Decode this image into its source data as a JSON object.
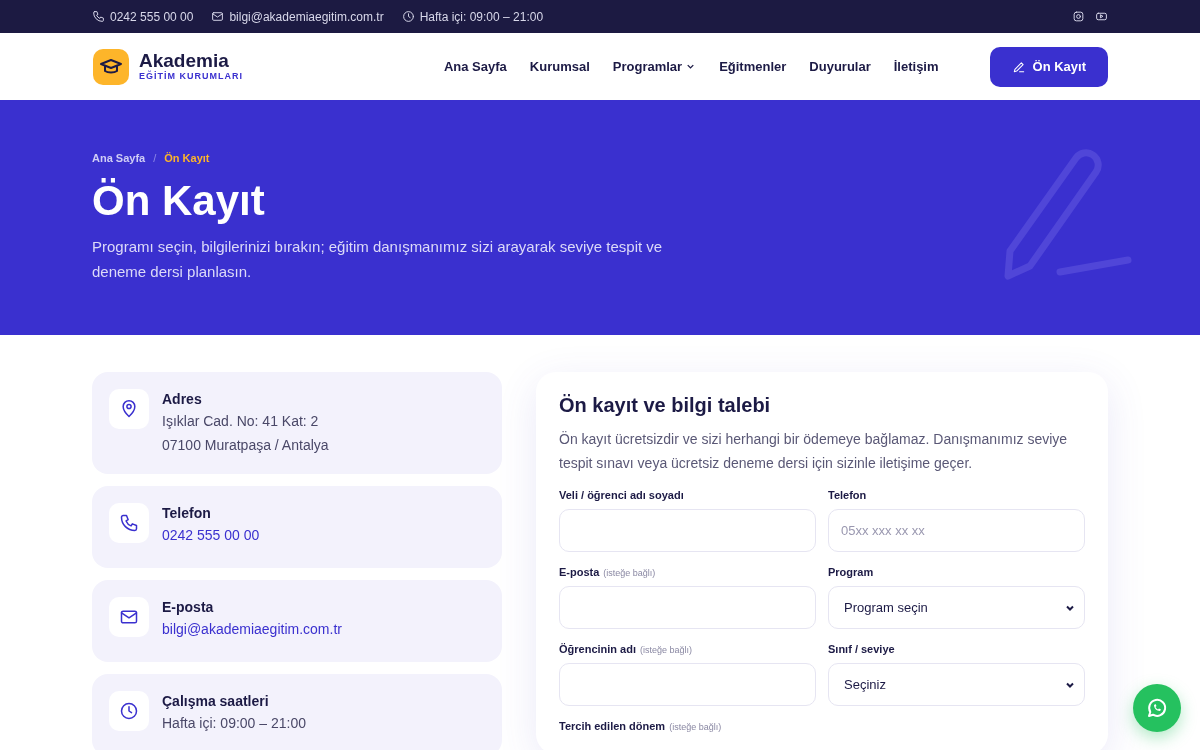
{
  "topbar": {
    "phone": "0242 555 00 00",
    "email": "bilgi@akademiaegitim.com.tr",
    "hours": "Hafta içi: 09:00 – 21:00"
  },
  "brand": {
    "name": "Akademia",
    "tagline": "EĞİTİM KURUMLARI"
  },
  "nav": [
    {
      "label": "Ana Sayfa",
      "dropdown": false
    },
    {
      "label": "Kurumsal",
      "dropdown": false
    },
    {
      "label": "Programlar",
      "dropdown": true
    },
    {
      "label": "Eğitmenler",
      "dropdown": false
    },
    {
      "label": "Duyurular",
      "dropdown": false
    },
    {
      "label": "İletişim",
      "dropdown": false
    }
  ],
  "cta": "Ön Kayıt",
  "hero": {
    "breadcrumb": [
      "Ana Sayfa",
      "Ön Kayıt"
    ],
    "separator": "/",
    "title": "Ön Kayıt",
    "lead": "Programı seçin, bilgilerinizi bırakın; eğitim danışmanımız sizi arayarak seviye tespit ve deneme dersi planlasın."
  },
  "contacts": [
    {
      "kind": "pin",
      "title": "Adres",
      "lines": [
        "Işıklar Cad. No: 41 Kat: 2",
        "07100 Muratpaşa / Antalya"
      ],
      "link": false
    },
    {
      "kind": "phone",
      "title": "Telefon",
      "lines": [
        "0242 555 00 00"
      ],
      "link": true
    },
    {
      "kind": "mail",
      "title": "E-posta",
      "lines": [
        "bilgi@akademiaegitim.com.tr"
      ],
      "link": true
    },
    {
      "kind": "clock",
      "title": "Çalışma saatleri",
      "lines": [
        "Hafta içi: 09:00 – 21:00"
      ],
      "link": false
    }
  ],
  "form": {
    "title": "Ön kayıt ve bilgi talebi",
    "intro": "Ön kayıt ücretsizdir ve sizi herhangi bir ödemeye bağlamaz. Danışmanımız seviye tespit sınavı veya ücretsiz deneme dersi için sizinle iletişime geçer.",
    "fields": [
      {
        "kind": "text",
        "label": "Veli / öğrenci adı soyadı"
      },
      {
        "kind": "text",
        "label": "Telefon",
        "placeholder": "05xx xxx xx xx"
      },
      {
        "kind": "text",
        "label": "E-posta",
        "note": "(isteğe bağlı)"
      },
      {
        "kind": "select",
        "label": "Program",
        "value": "Program seçin"
      },
      {
        "kind": "text",
        "label": "Öğrencinin adı",
        "note": "(isteğe bağlı)"
      },
      {
        "kind": "select",
        "label": "Sınıf / seviye",
        "value": "Seçiniz"
      },
      {
        "kind": "label",
        "label": "Tercih edilen dönem",
        "note": "(isteğe bağlı)"
      }
    ]
  }
}
